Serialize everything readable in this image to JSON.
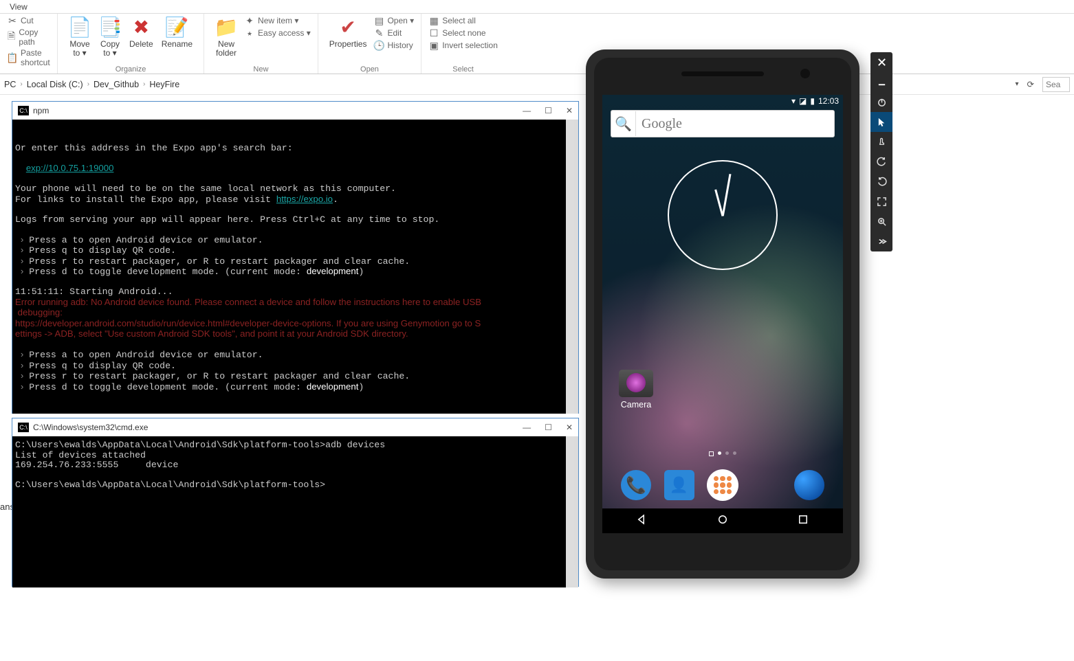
{
  "ribbon": {
    "tab": "View",
    "clipboard": {
      "cut": "Cut",
      "copy_path": "Copy path",
      "paste_shortcut": "Paste shortcut"
    },
    "organize": {
      "label": "Organize",
      "move_to": "Move\nto ▾",
      "copy_to": "Copy\nto ▾",
      "delete": "Delete",
      "rename": "Rename"
    },
    "new": {
      "label": "New",
      "new_folder": "New\nfolder",
      "new_item": "New item ▾",
      "easy_access": "Easy access ▾"
    },
    "open": {
      "label": "Open",
      "properties": "Properties",
      "open": "Open ▾",
      "edit": "Edit",
      "history": "History"
    },
    "select": {
      "label": "Select",
      "select_all": "Select all",
      "select_none": "Select none",
      "invert": "Invert selection"
    }
  },
  "breadcrumb": {
    "pc": "PC",
    "c": "Local Disk (C:)",
    "dev": "Dev_Github",
    "folder": "HeyFire"
  },
  "search_placeholder": "Sea",
  "fragment": "ans",
  "term1": {
    "title": "npm",
    "l1": "Or enter this address in the Expo app's search bar:",
    "url": "exp://10.0.75.1:19000",
    "l2": "Your phone will need to be on the same local network as this computer.",
    "l3a": "For links to install the Expo app, please visit ",
    "l3b": "https://expo.io",
    "l3c": ".",
    "l4": "Logs from serving your app will appear here. Press Ctrl+C at any time to stop.",
    "pa": "Press a to open Android device or emulator.",
    "pq": "Press q to display QR code.",
    "pr": "Press r to restart packager, or R to restart packager and clear cache.",
    "pd1": "Press d to toggle development mode. (current mode: ",
    "pd2": "development",
    "pd3": ")",
    "ts": "11:51:11: Starting Android...",
    "e1": "Error running adb: No Android device found. Please connect a device and follow the instructions here to enable USB",
    "e2": " debugging:",
    "e3": "https://developer.android.com/studio/run/device.html#developer-device-options. If you are using Genymotion go to S",
    "e4": "ettings -> ADB, select \"Use custom Android SDK tools\", and point it at your Android SDK directory."
  },
  "term2": {
    "title": "C:\\Windows\\system32\\cmd.exe",
    "l1": "C:\\Users\\ewalds\\AppData\\Local\\Android\\Sdk\\platform-tools>adb devices",
    "l2": "List of devices attached",
    "l3": "169.254.76.233:5555     device",
    "l4": "",
    "l5": "C:\\Users\\ewalds\\AppData\\Local\\Android\\Sdk\\platform-tools>"
  },
  "emulator": {
    "time": "12:03",
    "search": "Google",
    "camera": "Camera"
  }
}
